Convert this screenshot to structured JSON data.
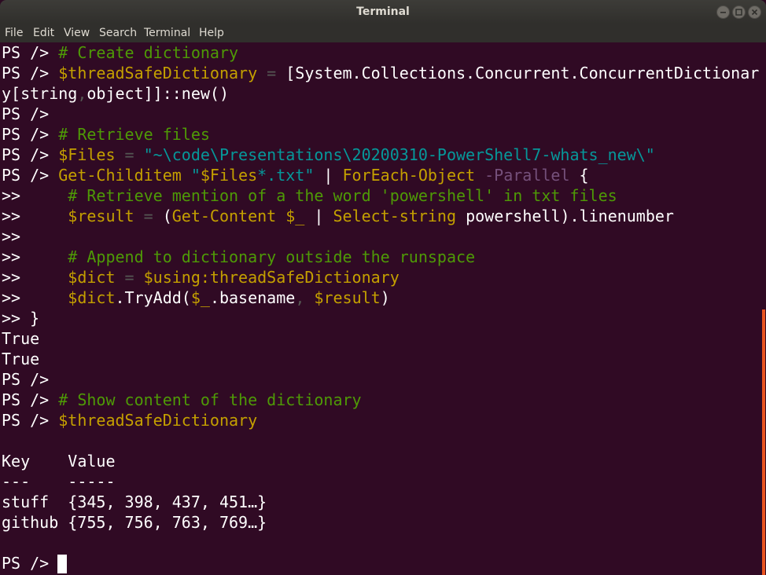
{
  "window": {
    "title": "Terminal"
  },
  "menu": [
    "File",
    "Edit",
    "View",
    "Search",
    "Terminal",
    "Help"
  ],
  "colors": {
    "background": "#300a24",
    "text": "#ffffff",
    "comment": "#4e9a06",
    "variable": "#c4a000",
    "string": "#06989a",
    "parameter": "#75507b",
    "operator": "#555753",
    "scrollbar": "#e95420"
  },
  "terminal": {
    "lines": [
      [
        [
          "PS /> ",
          "text"
        ],
        [
          "# Create dictionary",
          "comment"
        ]
      ],
      [
        [
          "PS /> ",
          "text"
        ],
        [
          "$threadSafeDictionary",
          "variable"
        ],
        [
          " = ",
          "operator"
        ],
        [
          "[System.Collections.Concurrent.ConcurrentDictionar",
          "text"
        ]
      ],
      [
        [
          "y[string",
          "text"
        ],
        [
          ",",
          "operator"
        ],
        [
          "object]]::new()",
          "text"
        ]
      ],
      [
        [
          "PS />",
          "text"
        ]
      ],
      [
        [
          "PS /> ",
          "text"
        ],
        [
          "# Retrieve files",
          "comment"
        ]
      ],
      [
        [
          "PS /> ",
          "text"
        ],
        [
          "$Files",
          "variable"
        ],
        [
          " = ",
          "operator"
        ],
        [
          "\"~\\code\\Presentations\\20200310-PowerShell7-whats_new\\\"",
          "string"
        ]
      ],
      [
        [
          "PS /> ",
          "text"
        ],
        [
          "Get-Childitem",
          "variable"
        ],
        [
          " ",
          "text"
        ],
        [
          "\"",
          "string"
        ],
        [
          "$Files",
          "variable"
        ],
        [
          "*.txt\"",
          "string"
        ],
        [
          " | ",
          "text"
        ],
        [
          "ForEach-Object",
          "variable"
        ],
        [
          " -Parallel",
          "parameter"
        ],
        [
          " {",
          "text"
        ]
      ],
      [
        [
          ">>     ",
          "text"
        ],
        [
          "# Retrieve mention of a the word 'powershell' in txt files",
          "comment"
        ]
      ],
      [
        [
          ">>     ",
          "text"
        ],
        [
          "$result",
          "variable"
        ],
        [
          " = ",
          "operator"
        ],
        [
          "(",
          "text"
        ],
        [
          "Get-Content",
          "variable"
        ],
        [
          " ",
          "text"
        ],
        [
          "$_",
          "variable"
        ],
        [
          " | ",
          "text"
        ],
        [
          "Select-string",
          "variable"
        ],
        [
          " powershell).linenumber",
          "text"
        ]
      ],
      [
        [
          ">>",
          "text"
        ]
      ],
      [
        [
          ">>     ",
          "text"
        ],
        [
          "# Append to dictionary outside the runspace",
          "comment"
        ]
      ],
      [
        [
          ">>     ",
          "text"
        ],
        [
          "$dict",
          "variable"
        ],
        [
          " = ",
          "operator"
        ],
        [
          "$using:threadSafeDictionary",
          "variable"
        ]
      ],
      [
        [
          ">>     ",
          "text"
        ],
        [
          "$dict",
          "variable"
        ],
        [
          ".TryAdd(",
          "text"
        ],
        [
          "$_",
          "variable"
        ],
        [
          ".basename",
          "text"
        ],
        [
          ", ",
          "operator"
        ],
        [
          "$result",
          "variable"
        ],
        [
          ")",
          "text"
        ]
      ],
      [
        [
          ">> }",
          "text"
        ]
      ],
      [
        [
          "True",
          "text"
        ]
      ],
      [
        [
          "True",
          "text"
        ]
      ],
      [
        [
          "PS />",
          "text"
        ]
      ],
      [
        [
          "PS /> ",
          "text"
        ],
        [
          "# Show content of the dictionary",
          "comment"
        ]
      ],
      [
        [
          "PS /> ",
          "text"
        ],
        [
          "$threadSafeDictionary",
          "variable"
        ]
      ],
      [
        [
          "",
          "text"
        ]
      ],
      [
        [
          "Key    Value",
          "text"
        ]
      ],
      [
        [
          "---    -----",
          "text"
        ]
      ],
      [
        [
          "stuff  {345, 398, 437, 451…}",
          "text"
        ]
      ],
      [
        [
          "github {755, 756, 763, 769…}",
          "text"
        ]
      ],
      [
        [
          "",
          "text"
        ]
      ],
      [
        [
          "PS /> ",
          "text"
        ]
      ]
    ]
  }
}
